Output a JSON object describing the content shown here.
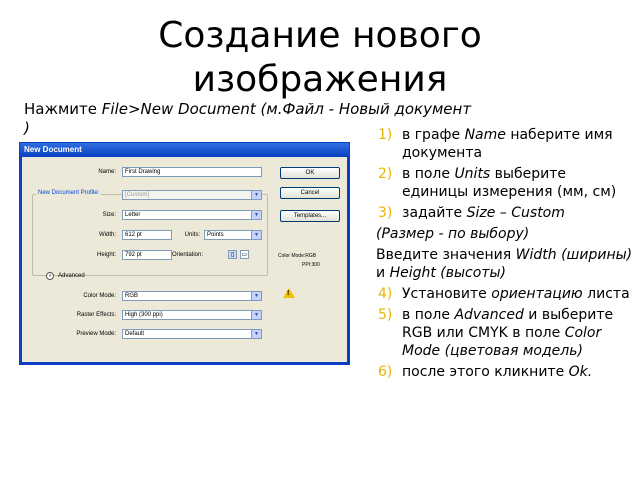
{
  "slide": {
    "title_line1": "Создание нового",
    "title_line2": "изображения",
    "intro_prefix": "Нажмите ",
    "intro_italic": "File>New Document (м.Файл - Новый документ )"
  },
  "dialog": {
    "title": "New Document",
    "name_label": "Name:",
    "name_value": "First Drawing",
    "profile_legend": "New Document Profile:",
    "profile_value": "[Custom]",
    "size_label": "Size:",
    "size_value": "Letter",
    "width_label": "Width:",
    "width_value": "612 pt",
    "units_label": "Units:",
    "units_value": "Points",
    "height_label": "Height:",
    "height_value": "792 pt",
    "orientation_label": "Orientation:",
    "color_mode_info": "Color Mode:RGB",
    "ppi_info": "PPI:300",
    "advanced_label": "Advanced",
    "color_mode_label": "Color Mode:",
    "color_mode_value": "RGB",
    "raster_label": "Raster Effects:",
    "raster_value": "High (300 ppi)",
    "preview_label": "Preview Mode:",
    "preview_value": "Default",
    "ok_label": "OK",
    "cancel_label": "Cancel",
    "templates_label": "Templates...",
    "warning_glyph": "!",
    "dropdown_glyph": "▼",
    "advanced_glyph": "«",
    "portrait_glyph": "▯",
    "landscape_glyph": "▭"
  },
  "steps": [
    {
      "num": "1)",
      "pre": " в графе ",
      "em": "Name",
      "post": " наберите имя документа"
    },
    {
      "num": "2)",
      "pre": " в поле ",
      "em": "Units",
      "post": " выберите единицы измерения (мм, см)"
    },
    {
      "num": "3)",
      "pre": " задайте ",
      "em": "Size – Custom",
      "post": ""
    }
  ],
  "note_size": "(Размер  - по выбору)",
  "enter_values": {
    "pre": "Введите значения ",
    "em1": "Width (ширины)",
    "mid": " и  ",
    "em2": "Height (высоты)"
  },
  "steps2": [
    {
      "num": "4)",
      "pre": " Установите ",
      "em": "ориентацию",
      "post": " листа"
    },
    {
      "num": "5)",
      "pre": " в поле ",
      "em": "Advanced",
      "post": " и выберите RGB  или CMYK в поле ",
      "em2": "Color Mode (цветовая модель)"
    },
    {
      "num": "6)",
      "pre": " после этого кликните ",
      "em": "Ok.",
      "post": ""
    }
  ],
  "colors": {
    "number_accent": "#e5b600",
    "titlebar": "#0a3fc0",
    "dialog_bg": "#ece9d8"
  }
}
